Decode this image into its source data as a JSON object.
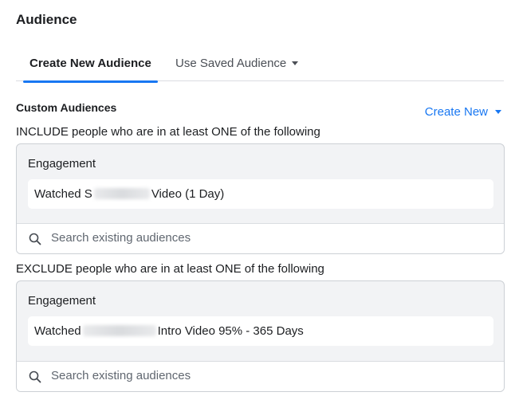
{
  "header": {
    "title": "Audience"
  },
  "tabs": [
    {
      "label": "Create New Audience",
      "active": true
    },
    {
      "label": "Use Saved Audience",
      "active": false
    }
  ],
  "custom_audiences": {
    "label": "Custom Audiences",
    "create_new_label": "Create New",
    "include": {
      "rule_text": "INCLUDE people who are in at least ONE of the following",
      "group_label": "Engagement",
      "item_prefix": "Watched S",
      "item_suffix": "Video (1 Day)",
      "search_placeholder": "Search existing audiences"
    },
    "exclude": {
      "rule_text": "EXCLUDE people who are in at least ONE of the following",
      "group_label": "Engagement",
      "item_prefix": "Watched",
      "item_suffix": "Intro Video 95% - 365 Days",
      "search_placeholder": "Search existing audiences"
    }
  },
  "colors": {
    "accent": "#1877f2",
    "panel_bg": "#f2f3f5",
    "border": "#ccd0d5"
  },
  "icons": {
    "search": "search-icon",
    "dropdown": "caret-down-icon"
  }
}
